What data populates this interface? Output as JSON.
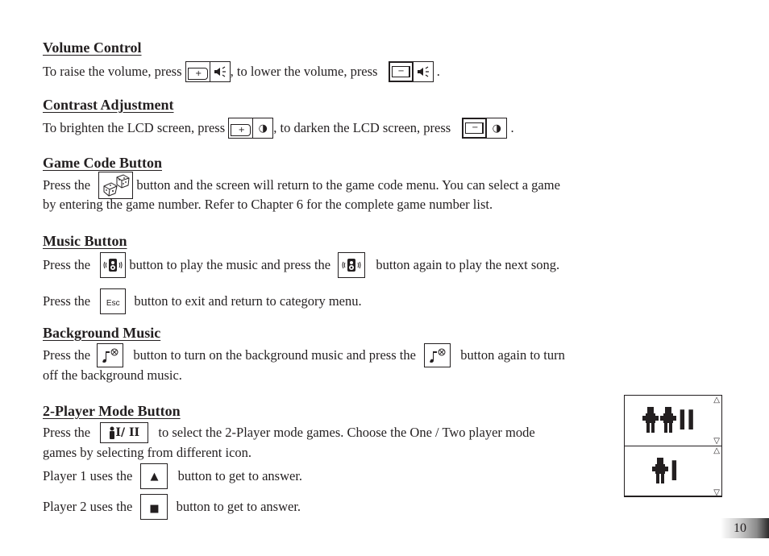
{
  "sections": {
    "volume": {
      "heading": "Volume Control",
      "text1": "To raise the volume, press ",
      "text2": ", to lower the volume, press ",
      "text3": " .",
      "raise_icon": "lcd-plus-speaker-icon",
      "lower_icon": "lcd-minus-speaker-icon",
      "plus": "+",
      "minus": "−"
    },
    "contrast": {
      "heading": "Contrast Adjustment",
      "text1": "To brighten the LCD screen, press ",
      "text2": ", to darken the LCD screen, press ",
      "text3": " .",
      "plus": "+",
      "minus": "−",
      "contrast_glyph": "◑"
    },
    "game_code": {
      "heading": "Game Code Button",
      "text1": "Press the ",
      "text2": " button and the screen will return to the game code menu. You can select a game",
      "line2": "by entering the game number. Refer to Chapter 6 for the complete game number list."
    },
    "music": {
      "heading": "Music Button",
      "text1": "Press the ",
      "text2": " button to play the music and press the ",
      "text3": " button again to play the next song.",
      "esc_text1": "Press the ",
      "esc_label": "Esc",
      "esc_text2": " button to exit and return to category menu."
    },
    "bg_music": {
      "heading": "Background Music",
      "text1": "Press the ",
      "text2": " button to turn on the background music and press the ",
      "text3": " button again to turn",
      "line2": "off the background music."
    },
    "two_player": {
      "heading": "2-Player Mode Button",
      "text1": "Press the ",
      "button_label": "I/ II",
      "text2": " to select the 2-Player mode games. Choose the One / Two player mode",
      "line2": "games by selecting from different icon.",
      "p1_text1": "Player 1 uses the ",
      "p1_glyph": "▲",
      "p1_text2": " button to get to answer.",
      "p2_text1": "Player 2 uses the ",
      "p2_glyph": "■",
      "p2_text2": " button to get to answer."
    }
  },
  "lcd_screens": {
    "top_label": "II",
    "bottom_label": "I",
    "up_arrow": "△",
    "down_arrow": "▽"
  },
  "page_number": "10"
}
